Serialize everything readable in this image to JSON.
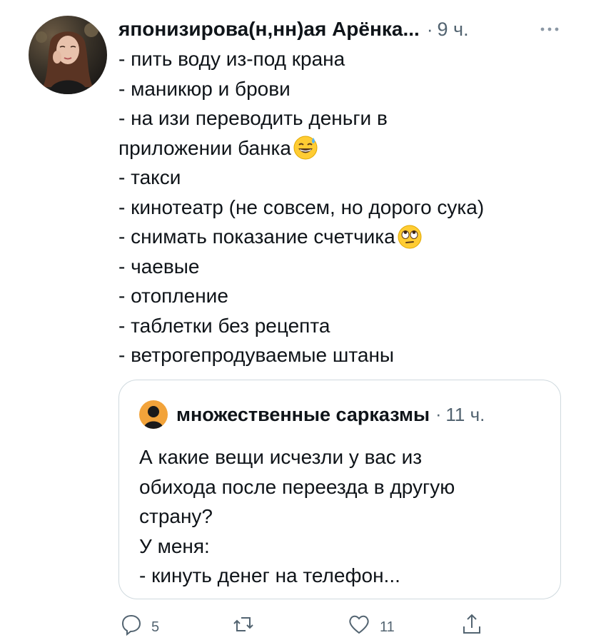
{
  "author": {
    "name": "японизирова(н,нн)ая Арёнка...",
    "time": "9 ч."
  },
  "tweet_lines": [
    {
      "text": "- пить воду из-под крана",
      "emoji": ""
    },
    {
      "text": "- маникюр и брови",
      "emoji": ""
    },
    {
      "text": "- на изи переводить деньги в",
      "emoji": ""
    },
    {
      "text": "приложении банка",
      "emoji": "grinning-sweat-emoji"
    },
    {
      "text": "- такси",
      "emoji": ""
    },
    {
      "text": "- кинотеатр (не совсем, но дорого сука)",
      "emoji": ""
    },
    {
      "text": "- снимать показание счетчика",
      "emoji": "eye-roll-emoji"
    },
    {
      "text": "- чаевые",
      "emoji": ""
    },
    {
      "text": "- отопление",
      "emoji": ""
    },
    {
      "text": "- таблетки без рецепта",
      "emoji": ""
    },
    {
      "text": "- ветрогепродуваемые штаны",
      "emoji": ""
    }
  ],
  "quoted": {
    "name": "множественные сарказмы",
    "time": "11 ч.",
    "lines": [
      "А какие вещи исчезли у вас из",
      "обихода после переезда в другую",
      "страну?",
      "У меня:",
      "- кинуть денег на телефон..."
    ]
  },
  "actions": {
    "reply_count": "5",
    "like_count": "11"
  },
  "colors": {
    "text": "#0f1419",
    "secondary": "#536471",
    "border": "#cfd9de",
    "quoted_avatar": "#f2a33a"
  }
}
